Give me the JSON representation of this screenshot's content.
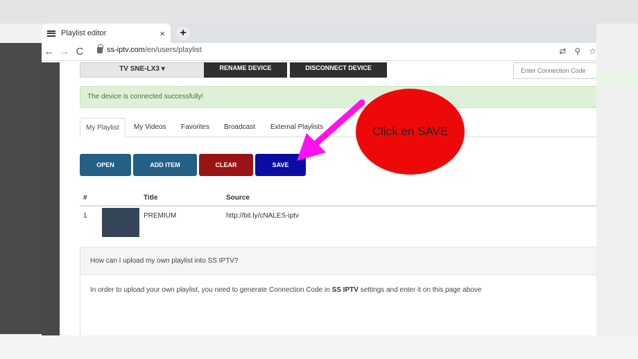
{
  "browser": {
    "tab_title": "Playlist editor",
    "tab_close": "×",
    "new_tab": "+",
    "url_host": "ss-iptv.com",
    "url_path": "/en/users/playlist",
    "nav_back": "←",
    "nav_forward": "→",
    "nav_reload": "C",
    "addr_icons": [
      "⇄",
      "⚲",
      "☆"
    ]
  },
  "device": {
    "selected": "TV SNE-LX3",
    "rename_label": "RENAME DEVICE",
    "disconnect_label": "DISCONNECT DEVICE",
    "connection_placeholder": "Enter Connection Code"
  },
  "alert": {
    "text": "The device is connected successfully!"
  },
  "tabs": [
    "My Playlist",
    "My Videos",
    "Favorites",
    "Broadcast",
    "External Playlists"
  ],
  "actions": {
    "open": "OPEN",
    "add_item": "ADD ITEM",
    "clear": "CLEAR",
    "save": "SAVE"
  },
  "table": {
    "headers": {
      "num": "#",
      "title": "Title",
      "source": "Source"
    },
    "rows": [
      {
        "num": "1",
        "title": "PREMIUM",
        "source": "http://bit.ly/cNALES-iptv"
      }
    ]
  },
  "faq": {
    "question": "How can I upload my own playlist into SS IPTV?",
    "answer_before": "In order to upload your own playlist, you need to generate Connection Code in ",
    "answer_bold": "SS IPTV",
    "answer_after": " settings and enter it on this page above"
  },
  "annotation": {
    "text": "Click en SAVE",
    "balloon_color": "#ee0909",
    "arrow_color": "#ff10ee"
  },
  "colors": {
    "primary_blue": "#245f86",
    "danger_red": "#9a1414",
    "save_blue": "#0a0ca4",
    "success_bg": "#dff0d8"
  }
}
